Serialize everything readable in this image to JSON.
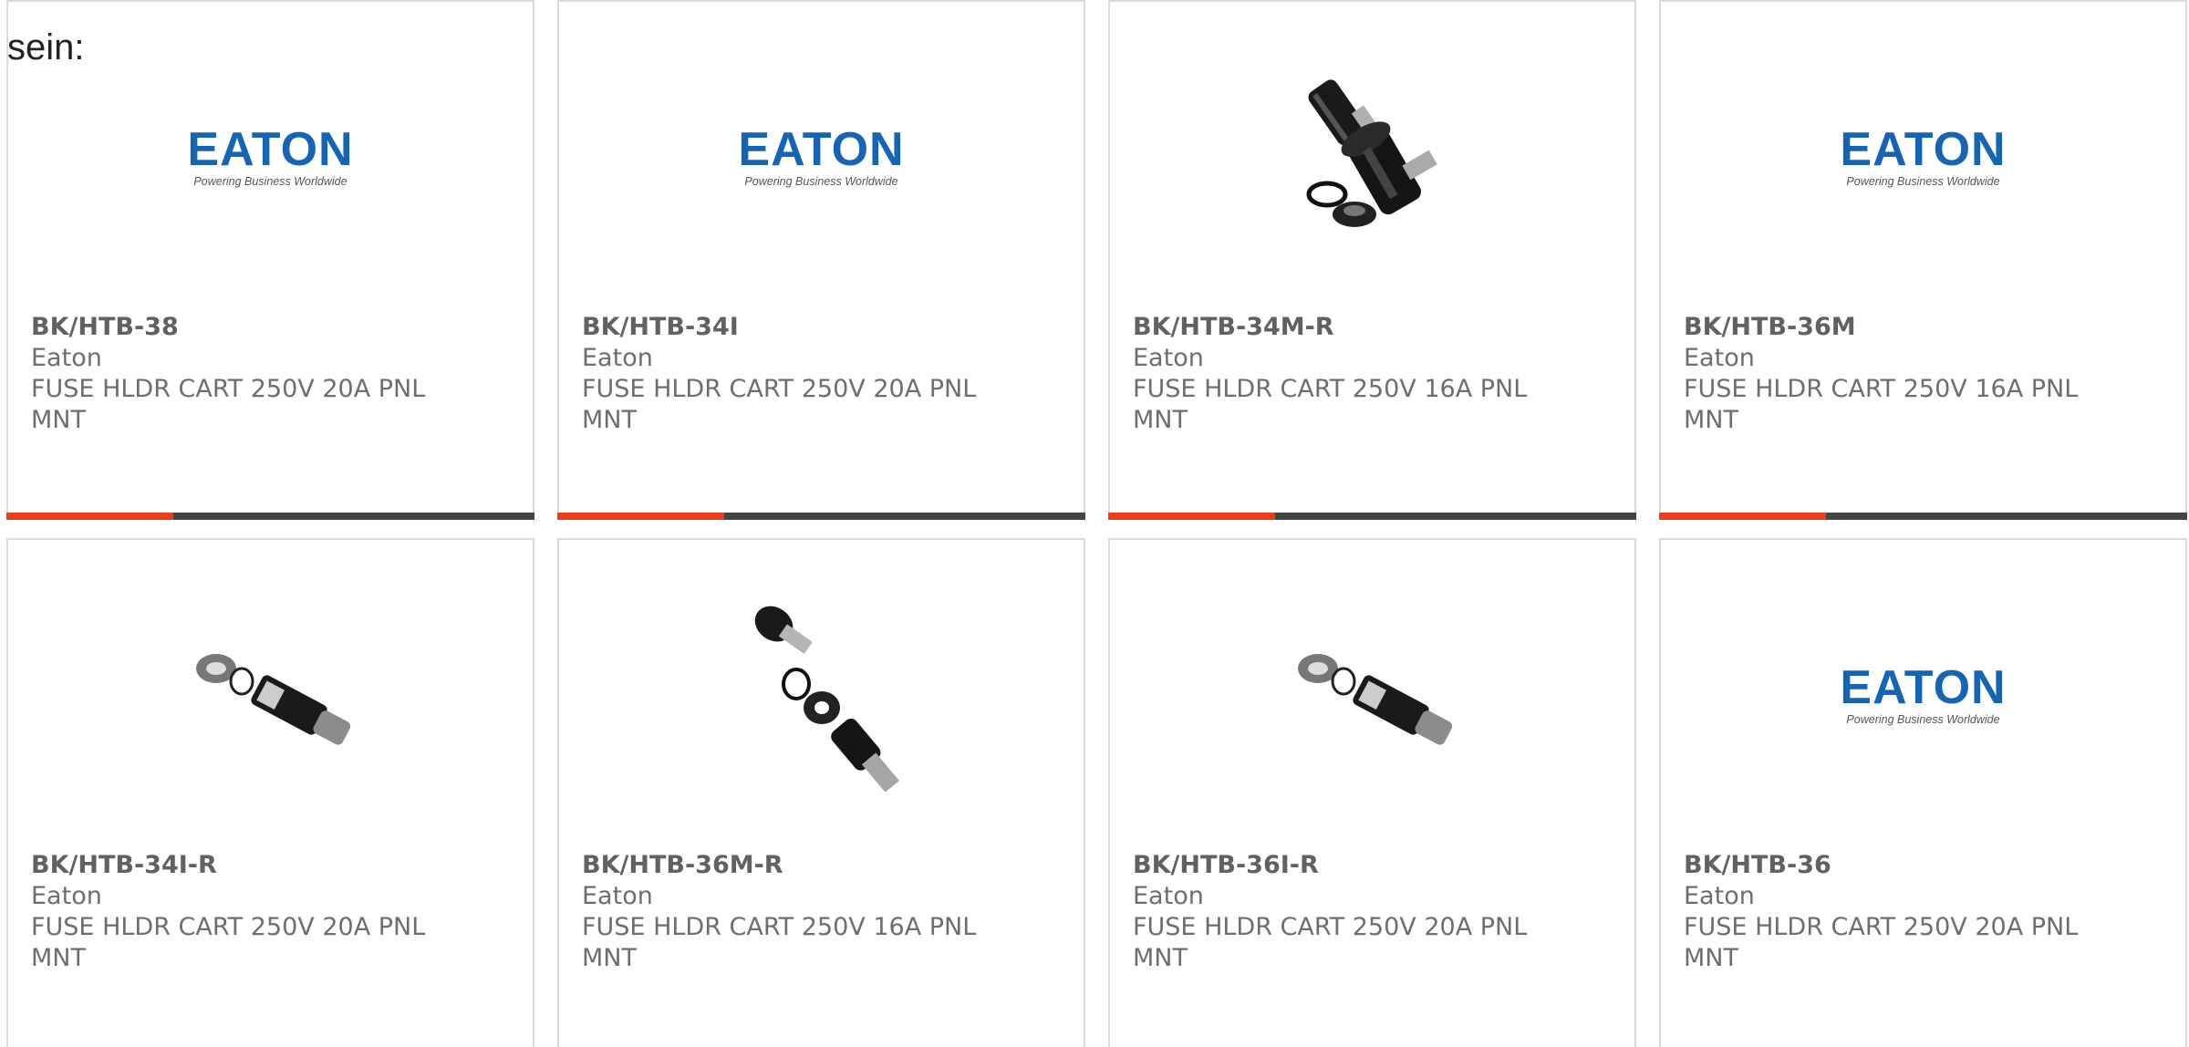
{
  "intro_text": "sein:",
  "logo": {
    "word": "EATON",
    "tagline": "Powering Business Worldwide"
  },
  "colors": {
    "accent": "#e8401c",
    "bar": "#444444",
    "brand": "#1665b4"
  },
  "products": [
    {
      "part": "BK/HTB-38",
      "brand": "Eaton",
      "desc": "FUSE HLDR CART 250V 20A PNL MNT",
      "image": "eaton-logo"
    },
    {
      "part": "BK/HTB-34I",
      "brand": "Eaton",
      "desc": "FUSE HLDR CART 250V 20A PNL MNT",
      "image": "eaton-logo"
    },
    {
      "part": "BK/HTB-34M-R",
      "brand": "Eaton",
      "desc": "FUSE HLDR CART 250V 16A PNL MNT",
      "image": "fuse-holder-vertical"
    },
    {
      "part": "BK/HTB-36M",
      "brand": "Eaton",
      "desc": "FUSE HLDR CART 250V 16A PNL MNT",
      "image": "eaton-logo"
    },
    {
      "part": "BK/HTB-34I-R",
      "brand": "Eaton",
      "desc": "FUSE HLDR CART 250V 20A PNL MNT",
      "image": "fuse-holder-diagonal"
    },
    {
      "part": "BK/HTB-36M-R",
      "brand": "Eaton",
      "desc": "FUSE HLDR CART 250V 16A PNL MNT",
      "image": "fuse-holder-exploded"
    },
    {
      "part": "BK/HTB-36I-R",
      "brand": "Eaton",
      "desc": "FUSE HLDR CART 250V 20A PNL MNT",
      "image": "fuse-holder-diagonal"
    },
    {
      "part": "BK/HTB-36",
      "brand": "Eaton",
      "desc": "FUSE HLDR CART 250V 20A PNL MNT",
      "image": "eaton-logo"
    }
  ]
}
